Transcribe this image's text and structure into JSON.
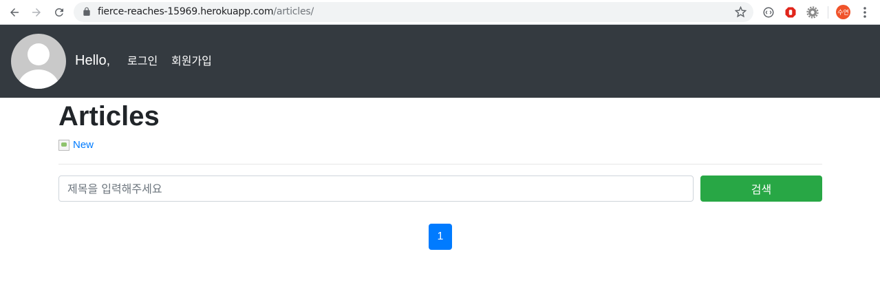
{
  "browser": {
    "url_host": "fierce-reaches-15969.herokuapp.com",
    "url_path": "/articles/",
    "profile_initials": "수연",
    "icons": [
      "back-arrow-icon",
      "forward-arrow-icon",
      "reload-icon",
      "lock-icon",
      "star-icon",
      "extension-icon",
      "stop-hand-icon",
      "gear-icon",
      "kebab-menu-icon"
    ]
  },
  "header": {
    "greeting": "Hello,",
    "nav": [
      {
        "label": "로그인"
      },
      {
        "label": "회원가입"
      }
    ],
    "background": "#343a40"
  },
  "main": {
    "title": "Articles",
    "new_link": "New",
    "search": {
      "placeholder": "제목을 입력해주세요",
      "value": "",
      "button_label": "검색"
    },
    "pagination": {
      "current_page": "1"
    }
  },
  "colors": {
    "primary": "#007bff",
    "success": "#28a745",
    "dark": "#343a40"
  }
}
